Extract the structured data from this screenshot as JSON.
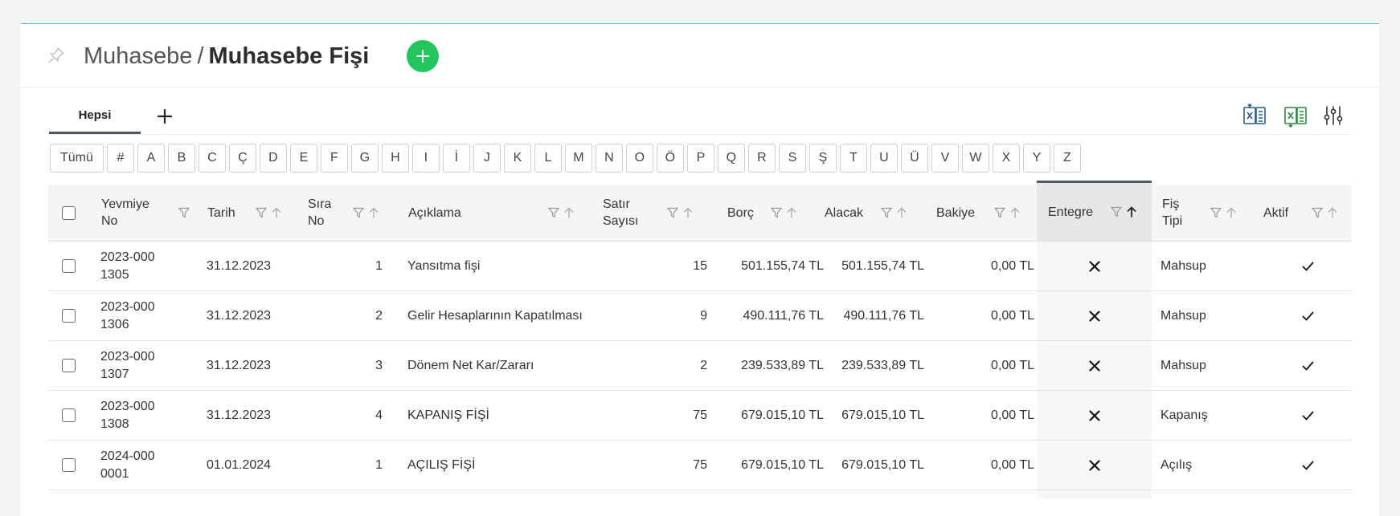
{
  "header": {
    "breadcrumb_parent": "Muhasebe",
    "breadcrumb_separator": "/",
    "breadcrumb_current": "Muhasebe Fişi"
  },
  "tabs": [
    {
      "label": "Hepsi",
      "active": true
    }
  ],
  "alphabet": [
    "Tümü",
    "#",
    "A",
    "B",
    "C",
    "Ç",
    "D",
    "E",
    "F",
    "G",
    "H",
    "I",
    "İ",
    "J",
    "K",
    "L",
    "M",
    "N",
    "O",
    "Ö",
    "P",
    "Q",
    "R",
    "S",
    "Ş",
    "T",
    "U",
    "Ü",
    "V",
    "W",
    "X",
    "Y",
    "Z"
  ],
  "columns": {
    "yevmiye_no": "Yevmiye No",
    "tarih": "Tarih",
    "sira_no": "Sıra No",
    "aciklama": "Açıklama",
    "satir_sayisi": "Satır Sayısı",
    "borc": "Borç",
    "alacak": "Alacak",
    "bakiye": "Bakiye",
    "entegre": "Entegre",
    "fis_tipi": "Fiş Tipi",
    "aktif": "Aktif"
  },
  "sorted_column": "entegre",
  "rows": [
    {
      "yevmiye_no": "2023-0001305",
      "tarih": "31.12.2023",
      "sira_no": "1",
      "aciklama": "Yansıtma fişi",
      "satir_sayisi": "15",
      "borc": "501.155,74 TL",
      "alacak": "501.155,74 TL",
      "bakiye": "0,00 TL",
      "entegre": false,
      "fis_tipi": "Mahsup",
      "aktif": true
    },
    {
      "yevmiye_no": "2023-0001306",
      "tarih": "31.12.2023",
      "sira_no": "2",
      "aciklama": "Gelir Hesaplarının Kapatılması",
      "satir_sayisi": "9",
      "borc": "490.111,76 TL",
      "alacak": "490.111,76 TL",
      "bakiye": "0,00 TL",
      "entegre": false,
      "fis_tipi": "Mahsup",
      "aktif": true
    },
    {
      "yevmiye_no": "2023-0001307",
      "tarih": "31.12.2023",
      "sira_no": "3",
      "aciklama": "Dönem Net Kar/Zararı",
      "satir_sayisi": "2",
      "borc": "239.533,89 TL",
      "alacak": "239.533,89 TL",
      "bakiye": "0,00 TL",
      "entegre": false,
      "fis_tipi": "Mahsup",
      "aktif": true
    },
    {
      "yevmiye_no": "2023-0001308",
      "tarih": "31.12.2023",
      "sira_no": "4",
      "aciklama": "KAPANIŞ FİŞİ",
      "satir_sayisi": "75",
      "borc": "679.015,10 TL",
      "alacak": "679.015,10 TL",
      "bakiye": "0,00 TL",
      "entegre": false,
      "fis_tipi": "Kapanış",
      "aktif": true
    },
    {
      "yevmiye_no": "2024-0000001",
      "tarih": "01.01.2024",
      "sira_no": "1",
      "aciklama": "AÇILIŞ FİŞİ",
      "satir_sayisi": "75",
      "borc": "679.015,10 TL",
      "alacak": "679.015,10 TL",
      "bakiye": "0,00 TL",
      "entegre": false,
      "fis_tipi": "Açılış",
      "aktif": true
    }
  ],
  "colors": {
    "accent_green": "#22c55e",
    "excel_blue": "#2b5d8f",
    "excel_green": "#2f8a3d",
    "top_line": "#5ab2e0"
  },
  "icons": {
    "pin": "pin-icon",
    "add": "plus-circle-icon",
    "export": "excel-export-icon",
    "import": "excel-import-icon",
    "settings": "sliders-icon"
  }
}
